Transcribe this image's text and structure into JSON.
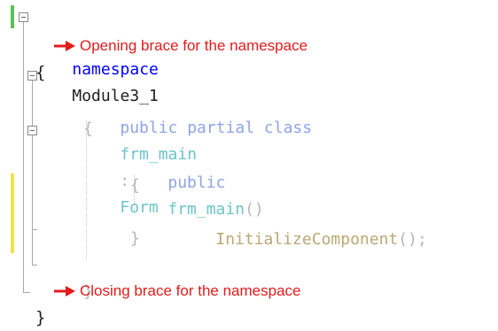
{
  "code": {
    "line1": {
      "keyword": "namespace",
      "name": "Module3_1"
    },
    "line2": {
      "brace": "{"
    },
    "line3": {
      "modifiers": "public partial class",
      "class_name": "frm_main",
      "colon": ":",
      "base": "Form"
    },
    "line4": {
      "brace": "{"
    },
    "line5": {
      "keyword": "public",
      "method": "frm_main",
      "parens": "()"
    },
    "line6": {
      "brace": "{"
    },
    "line7": {
      "call": "InitializeComponent",
      "tail": "();"
    },
    "line8": {
      "brace": "}"
    },
    "line10": {
      "brace": "}"
    },
    "line11": {
      "brace": "}"
    }
  },
  "annotations": {
    "opening": "Opening brace for the namespace",
    "closing": "Closing brace for the namespace"
  },
  "colors": {
    "keyword": "#0000ff",
    "annotation": "#e31b1b",
    "change_green": "#5cbf5c",
    "change_yellow": "#f1e14a"
  }
}
